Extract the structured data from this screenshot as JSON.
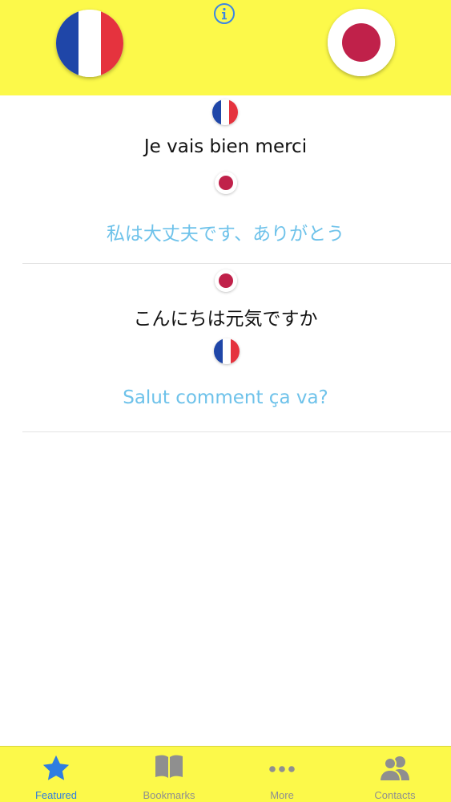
{
  "header": {
    "source_language": "French",
    "target_language": "Japanese",
    "info_icon": "info-icon"
  },
  "conversation": [
    {
      "speaker_flag": "france",
      "original": "Je vais bien merci",
      "reply_flag": "japan",
      "translation": "私は大丈夫です、ありがとう"
    },
    {
      "speaker_flag": "japan",
      "original": "こんにちは元気ですか",
      "reply_flag": "france",
      "translation": "Salut comment ça va?"
    }
  ],
  "tabbar": {
    "tabs": [
      {
        "label": "Featured",
        "icon": "star-icon",
        "active": true
      },
      {
        "label": "Bookmarks",
        "icon": "book-icon",
        "active": false
      },
      {
        "label": "More",
        "icon": "ellipsis-icon",
        "active": false
      },
      {
        "label": "Contacts",
        "icon": "contacts-icon",
        "active": false
      }
    ]
  },
  "colors": {
    "header_background": "#fcf94a",
    "translation_text": "#6ec2ea",
    "active_tab": "#2f7de0",
    "inactive_tab": "#8f8f8f"
  }
}
